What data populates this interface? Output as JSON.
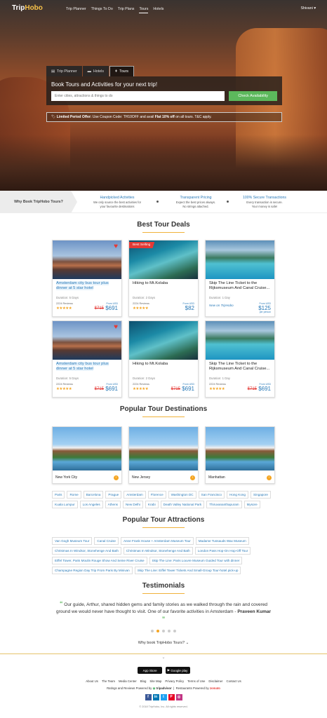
{
  "header": {
    "logo_a": "Trip",
    "logo_b": "Hobo",
    "nav": [
      "Trip Planner",
      "Things To Do",
      "Trip Plans",
      "Tours",
      "Hotels"
    ],
    "user": "Shivani ▾"
  },
  "search": {
    "tabs": [
      "Trip Planner",
      "Hotels",
      "Tours"
    ],
    "heading": "Book Tours and Activities for your next trip!",
    "placeholder": "Enter cities, attractions & things to do",
    "button": "Check Availability",
    "offer_label": "Limited Period Offer:",
    "offer_text": "Use Coupon Code: TH10OFF and avail",
    "offer_bold": "Flat 10% off",
    "offer_tail": "on all tours. T&C apply."
  },
  "why": {
    "label": "Why Book TripHobo Tours?",
    "items": [
      {
        "title": "Handpicked Activities",
        "line1": "We only source the best activities for",
        "line2": "your favourite destinations"
      },
      {
        "title": "Transparent Pricing",
        "line1": "Expect the best prices always.",
        "line2": "No strings attached."
      },
      {
        "title": "100% Secure Transactions",
        "line1": "Every transaction is secure.",
        "line2": "Your money is safe!"
      }
    ]
  },
  "deals": {
    "title": "Best Tour Deals",
    "badge": "Best Selling",
    "row1": [
      {
        "title": "Amsterdam city bus tour plus dinner at 5 star hotel",
        "duration": "Duration: 5 Days",
        "reviews": "2224 Reviews",
        "from": "From USD",
        "old": "$715",
        "price": "$691"
      },
      {
        "title": "Hiking to Mt.Kolaba",
        "duration": "Duration: 2 Days",
        "reviews": "2224 Reviews",
        "from": "From USD",
        "old": "",
        "price": "$82"
      },
      {
        "title": "Skip The Line Ticket to the Rijksmuseum And Canal Cruise...",
        "duration": "Duration: 1 Day",
        "reviews": "",
        "from": "From USD",
        "old": "",
        "price": "$125",
        "triphobo": "New on TripHobo",
        "per": "per person"
      }
    ],
    "row2": [
      {
        "title": "Amsterdam city bus tour plus dinner at 5 star hotel",
        "duration": "Duration: 5 Days",
        "reviews": "2224 Reviews",
        "from": "From USD",
        "old": "$715",
        "price": "$691"
      },
      {
        "title": "Hiking to Mt.Kolaba",
        "duration": "Duration: 2 Days",
        "reviews": "2224 Reviews",
        "from": "From USD",
        "old": "$715",
        "price": "$691"
      },
      {
        "title": "Skip The Line Ticket to the Rijksmuseum And Canal Cruise...",
        "duration": "Duration: 1 Day",
        "reviews": "2224 Reviews",
        "from": "From USD",
        "old": "$715",
        "price": "$691"
      }
    ]
  },
  "destinations": {
    "title": "Popular Tour Destinations",
    "cards": [
      "New York City",
      "New Jersey",
      "Manhattan"
    ],
    "chips": [
      "Paris",
      "Rome",
      "Barcelona",
      "Prague",
      "Amsterdam",
      "Florence",
      "Washington DC",
      "San Francisco",
      "Hong Kong",
      "Singapore",
      "Kuala Lumpur",
      "Los Angeles",
      "Athens",
      "New Delhi",
      "Krabi",
      "Death Valley National Park",
      "Thiruvananthapuram",
      "Mysore"
    ]
  },
  "attractions": {
    "title": "Popular Tour Attractions",
    "chips": [
      "Van Gogh Museum Tour",
      "Canal Cruise",
      "Anne Frank House + Amsterdam Museum Tour",
      "Madame Tussauds Wax Museum",
      "Christmas In Windsor, Stonehenge And Bath",
      "Christmas In Windsor, Stonehenge And Bath",
      "London Pass Hop-On Hop-Off Tour",
      "Eiffel Tower, Paris Moulin Rouge Show And Seine River Cruise",
      "Skip The Line: Paris Louvre Museum Guided Tour with dinner",
      "Champagne Region Day Trip From Paris By Minivan",
      "Skip The Line: Eiffel Tower Tickets And Small-Group Tour-hotel pick-up"
    ]
  },
  "testimonials": {
    "title": "Testimonials",
    "quote": "Our guide, Arthur, shared hidden gems and family stories as we walked through the rain and covered ground we would never have thought to visit. One of our favorite activities in Amsterdam -",
    "author": "Praveen Kumar",
    "why_link": "Why book TripHobo Tours?"
  },
  "footer": {
    "app_store": "App Store",
    "google_play": "Google play",
    "links": [
      "About Us",
      "The Team",
      "Media Center",
      "Blog",
      "Site Map",
      "Privacy Policy",
      "Terms of Use",
      "Disclaimer",
      "Contact Us"
    ],
    "ratings": "Ratings and Reviews Powered by",
    "tripadvisor": "tripadvisor",
    "restaurants": "Restaurants Powered by",
    "zomato": "zomato",
    "social": [
      "f",
      "in",
      "t",
      "P",
      "◎"
    ],
    "copyright": "© 2018 TripHobo, Inc. All rights reserved."
  },
  "colors": {
    "accent": "#2a7ab8",
    "cta": "#5cb85c",
    "gold": "#f5a623",
    "badge": "#e53935"
  }
}
